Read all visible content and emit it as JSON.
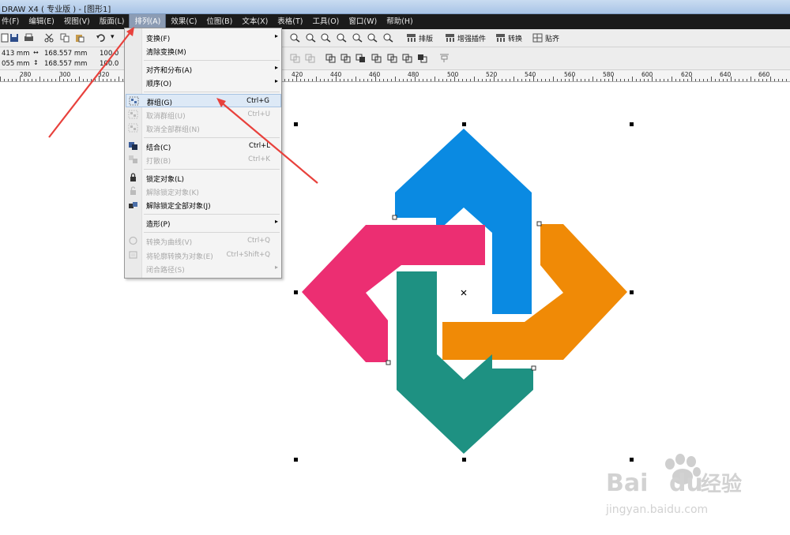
{
  "window": {
    "title": "DRAW X4 ( 专业版 ) - [图形1]"
  },
  "menubar": {
    "items": [
      "件(F)",
      "编辑(E)",
      "视图(V)",
      "版面(L)",
      "排列(A)",
      "效果(C)",
      "位图(B)",
      "文本(X)",
      "表格(T)",
      "工具(O)",
      "窗口(W)",
      "帮助(H)"
    ]
  },
  "toolbar": {
    "plugins": [
      "排版",
      "增强插件",
      "转换",
      "贴齐"
    ]
  },
  "property_bar": {
    "x": "413 mm",
    "y": "055 mm",
    "width": "168.557 mm",
    "height": "168.557 mm",
    "scale_w": "100.0",
    "scale_h": "100.0"
  },
  "ruler": {
    "labels": [
      "280",
      "300",
      "320",
      "420",
      "440",
      "460",
      "480",
      "500",
      "520",
      "540",
      "560",
      "580",
      "600",
      "620",
      "640",
      "660"
    ]
  },
  "arrange_menu": {
    "items": [
      {
        "label": "变换(F)",
        "shortcut": "",
        "submenu": true,
        "enabled": true
      },
      {
        "label": "清除变换(M)",
        "shortcut": "",
        "submenu": false,
        "enabled": true
      },
      {
        "label": "对齐和分布(A)",
        "shortcut": "",
        "submenu": true,
        "enabled": true
      },
      {
        "label": "顺序(O)",
        "shortcut": "",
        "submenu": true,
        "enabled": true
      },
      {
        "label": "群组(G)",
        "shortcut": "Ctrl+G",
        "submenu": false,
        "enabled": true,
        "highlighted": true
      },
      {
        "label": "取消群组(U)",
        "shortcut": "Ctrl+U",
        "submenu": false,
        "enabled": false
      },
      {
        "label": "取消全部群组(N)",
        "shortcut": "",
        "submenu": false,
        "enabled": false
      },
      {
        "label": "结合(C)",
        "shortcut": "Ctrl+L",
        "submenu": false,
        "enabled": true
      },
      {
        "label": "打散(B)",
        "shortcut": "Ctrl+K",
        "submenu": false,
        "enabled": false
      },
      {
        "label": "锁定对象(L)",
        "shortcut": "",
        "submenu": false,
        "enabled": true
      },
      {
        "label": "解除锁定对象(K)",
        "shortcut": "",
        "submenu": false,
        "enabled": false
      },
      {
        "label": "解除锁定全部对象(J)",
        "shortcut": "",
        "submenu": false,
        "enabled": true
      },
      {
        "label": "造形(P)",
        "shortcut": "",
        "submenu": true,
        "enabled": true
      },
      {
        "label": "转换为曲线(V)",
        "shortcut": "Ctrl+Q",
        "submenu": false,
        "enabled": false
      },
      {
        "label": "将轮廓转换为对象(E)",
        "shortcut": "Ctrl+Shift+Q",
        "submenu": false,
        "enabled": false
      },
      {
        "label": "闭合路径(S)",
        "shortcut": "",
        "submenu": true,
        "enabled": false
      }
    ]
  },
  "shapes": {
    "colors": {
      "blue": "#0a8ae2",
      "orange": "#f08a06",
      "teal": "#1e9182",
      "pink": "#ec2e72"
    }
  },
  "annotations": {
    "arrow_color": "#e8413c"
  },
  "watermark": {
    "brand": "Bai",
    "brand2": "du",
    "cn": "经验",
    "url": "jingyan.baidu.com"
  }
}
